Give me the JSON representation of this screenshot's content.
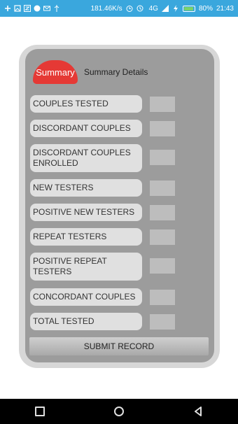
{
  "status_bar": {
    "network_speed": "181.46K/s",
    "signal": "4G",
    "battery_percent": "80%",
    "time": "21:43",
    "icons": [
      "plus-icon",
      "image-icon",
      "z-icon",
      "circle-icon",
      "mail-icon",
      "usb-icon",
      "alarm-icon",
      "signal-icon",
      "charging-icon"
    ]
  },
  "header": {
    "badge": "Summary",
    "title": "Summary Details"
  },
  "fields": [
    {
      "label": "COUPLES TESTED",
      "value": ""
    },
    {
      "label": "DISCORDANT COUPLES",
      "value": ""
    },
    {
      "label": "DISCORDANT COUPLES ENROLLED",
      "value": ""
    },
    {
      "label": "NEW TESTERS",
      "value": ""
    },
    {
      "label": "POSITIVE NEW TESTERS",
      "value": ""
    },
    {
      "label": "REPEAT TESTERS",
      "value": ""
    },
    {
      "label": "POSITIVE REPEAT TESTERS",
      "value": ""
    },
    {
      "label": "CONCORDANT COUPLES",
      "value": ""
    },
    {
      "label": "TOTAL TESTED",
      "value": ""
    }
  ],
  "submit_label": "SUBMIT RECORD",
  "colors": {
    "status_bar": "#3aa7dd",
    "badge": "#e53935",
    "card_outer": "#d7d7d7",
    "card_inner": "#9c9c9c"
  },
  "nav": [
    "recent-apps-icon",
    "home-icon",
    "back-icon"
  ]
}
